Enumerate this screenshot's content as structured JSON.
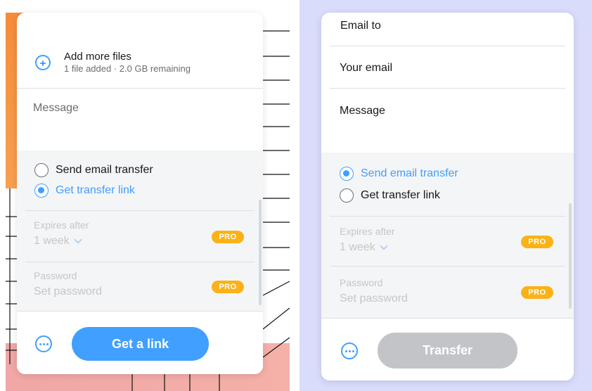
{
  "left": {
    "add_files": {
      "title": "Add more files",
      "subtitle": "1 file added · 2.0 GB remaining"
    },
    "message_placeholder": "Message",
    "radios": [
      {
        "label": "Send email transfer",
        "selected": false
      },
      {
        "label": "Get transfer link",
        "selected": true
      }
    ],
    "expires": {
      "label": "Expires after",
      "value": "1 week",
      "badge": "PRO"
    },
    "password": {
      "label": "Password",
      "value": "Set password",
      "badge": "PRO"
    },
    "action_label": "Get a link"
  },
  "right": {
    "fields": {
      "email_to": "Email to",
      "your_email": "Your email",
      "message": "Message"
    },
    "radios": [
      {
        "label": "Send email transfer",
        "selected": true
      },
      {
        "label": "Get transfer link",
        "selected": false
      }
    ],
    "expires": {
      "label": "Expires after",
      "value": "1 week",
      "badge": "PRO"
    },
    "password": {
      "label": "Password",
      "value": "Set password",
      "badge": "PRO"
    },
    "action_label": "Transfer"
  },
  "colors": {
    "accent": "#409fff",
    "pro_badge": "#fbb216",
    "disabled_button": "#c2c4c8",
    "right_background": "#d9dcfb"
  }
}
